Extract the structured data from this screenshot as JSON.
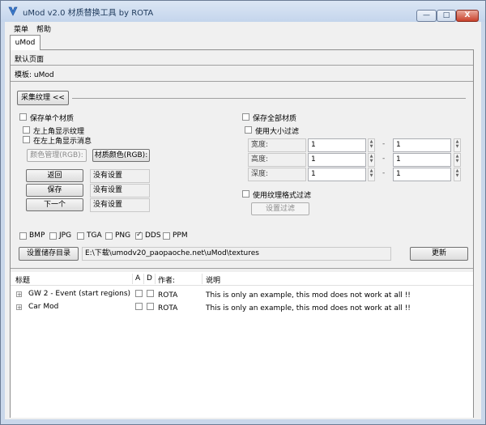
{
  "window": {
    "title": "uMod v2.0 材质替换工具 by ROTA",
    "minimize": "—",
    "maximize": "□",
    "close": "X"
  },
  "menu": [
    "菜单",
    "帮助"
  ],
  "tab": {
    "label": "uMod"
  },
  "page": {
    "default_page": "默认页面",
    "template": "模板: uMod"
  },
  "capture_button": "采集纹理 <<",
  "left_options": {
    "save_single": "保存单个材质",
    "show_top_left": "左上角显示纹理",
    "show_message": "在左上角显示消息",
    "color_manage": "颜色管理(RGB):",
    "material_color": "材质颜色(RGB):"
  },
  "actions": [
    {
      "button": "返回",
      "value": "没有设置"
    },
    {
      "button": "保存",
      "value": "没有设置"
    },
    {
      "button": "下一个",
      "value": "没有设置"
    }
  ],
  "right_options": {
    "save_all": "保存全部材质",
    "use_size_filter": "使用大小过滤",
    "filters": [
      {
        "label": "宽度:",
        "min": "1",
        "max": "1"
      },
      {
        "label": "高度:",
        "min": "1",
        "max": "1"
      },
      {
        "label": "深度:",
        "min": "1",
        "max": "1"
      }
    ],
    "use_format_filter": "使用纹理格式过滤",
    "set_filter": "设置过滤"
  },
  "formats": [
    {
      "label": "BMP",
      "checked": false
    },
    {
      "label": "JPG",
      "checked": false
    },
    {
      "label": "TGA",
      "checked": false
    },
    {
      "label": "PNG",
      "checked": false
    },
    {
      "label": "DDS",
      "checked": true
    },
    {
      "label": "PPM",
      "checked": false
    }
  ],
  "storage": {
    "button": "设置储存目录",
    "path": "E:\\下载\\umodv20_paopaoche.net\\uMod\\textures",
    "update": "更新"
  },
  "list": {
    "columns": [
      "标题",
      "A",
      "D",
      "作者:",
      "说明"
    ],
    "rows": [
      {
        "title": "GW 2 - Event  (start regions)",
        "a": false,
        "d": false,
        "author": "ROTA",
        "desc": "This is only an example, this mod does not work at all !!"
      },
      {
        "title": "Car Mod",
        "a": false,
        "d": false,
        "author": "ROTA",
        "desc": "This is only an example, this mod does not work at all !!"
      }
    ]
  }
}
